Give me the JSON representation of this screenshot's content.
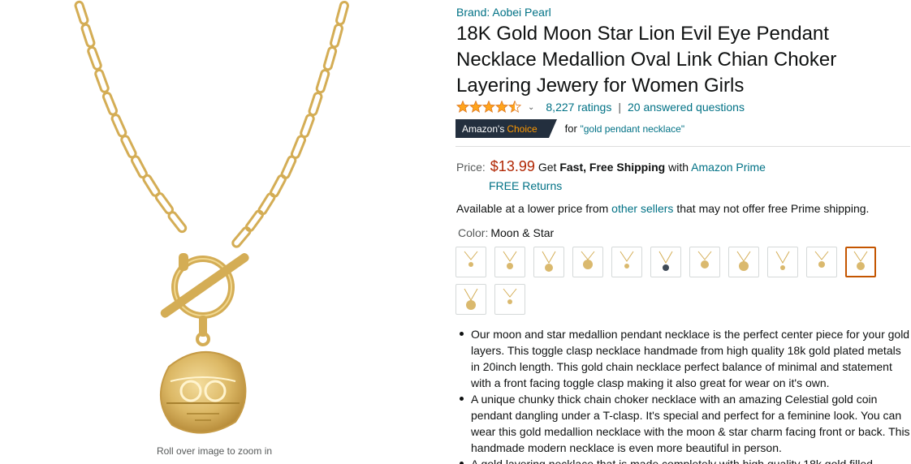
{
  "gallery": {
    "zoom_hint": "Roll over image to zoom in"
  },
  "product": {
    "brand": "Brand: Aobei Pearl",
    "title": "18K Gold Moon Star Lion Evil Eye Pendant Necklace Medallion Oval Link Chian Choker Layering Jewery for Women Girls",
    "rating": 4.5,
    "ratings_count": "8,227 ratings",
    "answered_questions": "20 answered questions",
    "badge": {
      "prefix": "Amazon's",
      "highlight": "Choice"
    },
    "choice_for": "for ",
    "choice_query": "\"gold pendant necklace\""
  },
  "pricing": {
    "label": "Price:",
    "price": "$13.99",
    "shipping_prefix": "Get",
    "shipping_bold": "Fast, Free Shipping",
    "shipping_with": "with",
    "prime_link": "Amazon Prime",
    "free_returns": "FREE Returns"
  },
  "availability": {
    "text_before": "Available at a lower price from ",
    "link": "other sellers",
    "text_after": " that may not offer free Prime shipping."
  },
  "color": {
    "label": "Color:",
    "selected": "Moon & Star",
    "swatch_count": 13
  },
  "bullets": [
    "Our moon and star medallion pendant necklace is the perfect center piece for your gold layers. This toggle clasp necklace handmade from high quality 18k gold plated metals in 20inch length. This gold chain necklace perfect balance of minimal and statement with a front facing toggle clasp making it also great for wear on it's own.",
    "A unique chunky thick chain choker necklace with an amazing Celestial gold coin pendant dangling under a T-clasp. It's special and perfect for a feminine look. You can wear this gold medallion necklace with the moon & star charm facing front or back. This handmade modern necklace is even more beautiful in person.",
    "A gold layering necklace that is made completely with high quality 18k gold filled"
  ],
  "colors": {
    "link": "#007185",
    "price": "#b12704",
    "badge_bg": "#232f3e",
    "badge_accent": "#ff9900",
    "star": "#ffa41c",
    "gold": "#d4ad55",
    "selected_border": "#c45500"
  }
}
